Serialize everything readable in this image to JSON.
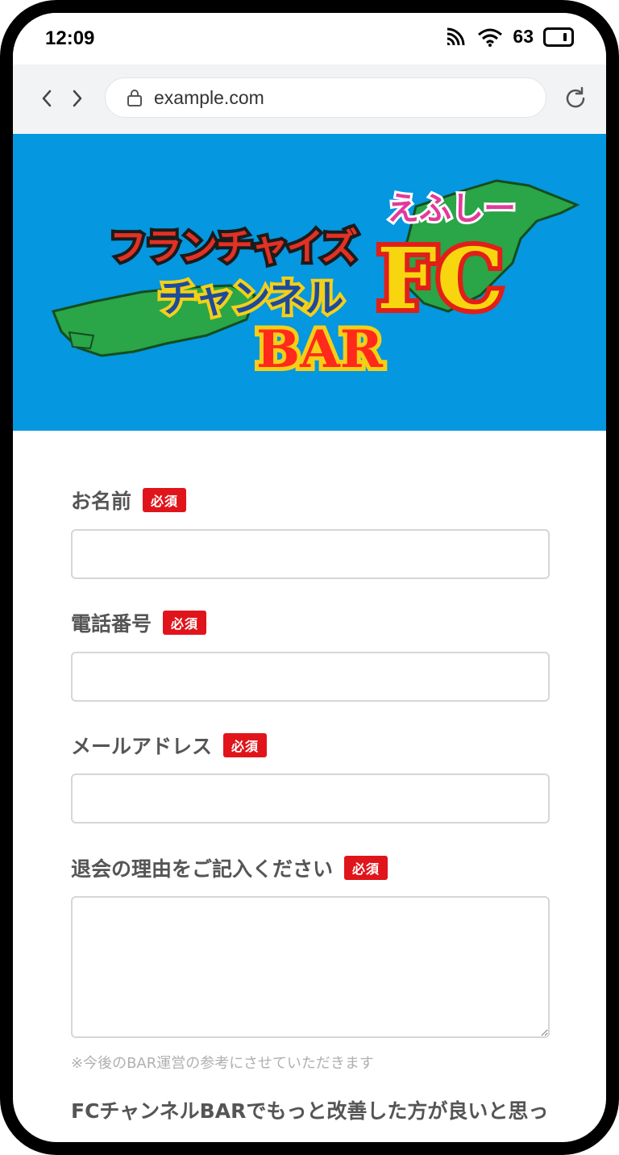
{
  "status_bar": {
    "time": "12:09",
    "battery": "63"
  },
  "browser": {
    "url": "example.com"
  },
  "hero": {
    "logo": {
      "line1": "フランチャイズ",
      "line2": "チャンネル",
      "kana": "えふしー",
      "fc": "FC",
      "bar": "BAR"
    },
    "background_color": "#0597e0"
  },
  "form": {
    "required_label": "必須",
    "fields": [
      {
        "label": "お名前",
        "value": ""
      },
      {
        "label": "電話番号",
        "value": ""
      },
      {
        "label": "メールアドレス",
        "value": ""
      }
    ],
    "reason": {
      "label": "退会の理由をご記入ください",
      "value": "",
      "note": "※今後のBAR運営の参考にさせていただきます"
    },
    "improvement": {
      "label": "FCチャンネルBARでもっと改善した方が良いと思った点を教えてください"
    }
  },
  "colors": {
    "required_badge": "#e0151b",
    "browser_bar": "#f1f3f5"
  }
}
